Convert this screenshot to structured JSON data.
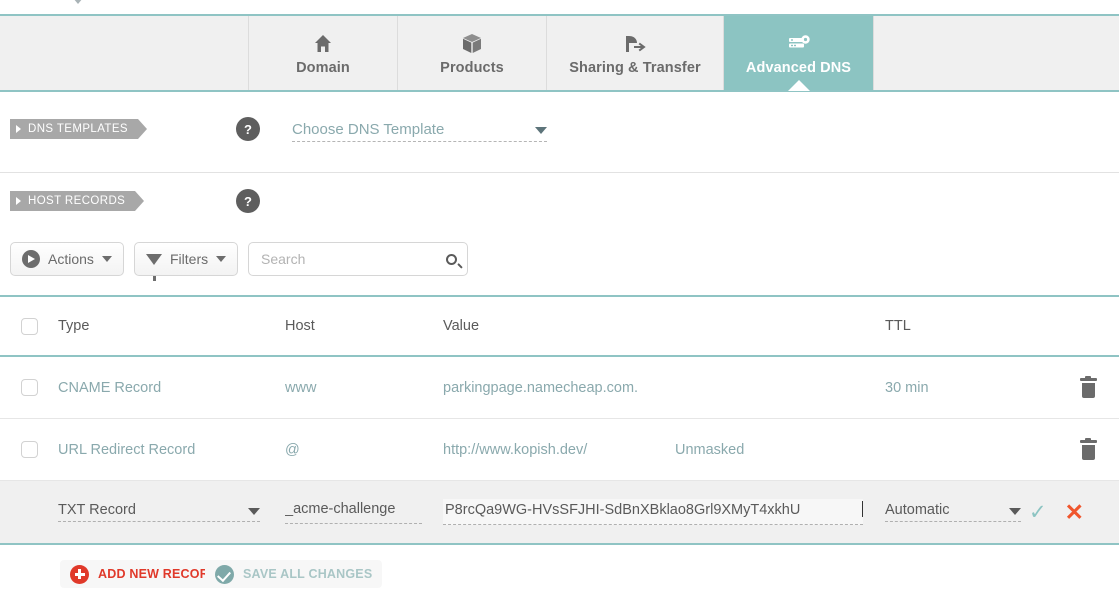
{
  "tabs": [
    {
      "label": "Domain",
      "icon": "home-icon",
      "active": false
    },
    {
      "label": "Products",
      "icon": "box-icon",
      "active": false
    },
    {
      "label": "Sharing & Transfer",
      "icon": "transfer-icon",
      "active": false
    },
    {
      "label": "Advanced DNS",
      "icon": "server-gear-icon",
      "active": true
    }
  ],
  "sections": {
    "dns_templates": {
      "label": "DNS TEMPLATES",
      "help": "?",
      "template_select": {
        "value": "Choose DNS Template"
      }
    },
    "host_records": {
      "label": "HOST RECORDS",
      "help": "?"
    }
  },
  "toolbar": {
    "actions_label": "Actions",
    "filters_label": "Filters",
    "search": {
      "value": "",
      "placeholder": "Search"
    }
  },
  "table": {
    "columns": [
      "Type",
      "Host",
      "Value",
      "TTL"
    ],
    "rows": [
      {
        "type": "CNAME Record",
        "host": "www",
        "value": "parkingpage.namecheap.com.",
        "value2": "",
        "ttl": "30 min"
      },
      {
        "type": "URL Redirect Record",
        "host": "@",
        "value": "http://www.kopish.dev/",
        "value2": "Unmasked",
        "ttl": ""
      }
    ],
    "edit_row": {
      "type": "TXT Record",
      "host": "_acme-challenge",
      "value": "P8rcQa9WG-HVsSFJHI-SdBnXBklao8Grl9XMyT4xkhU",
      "ttl": "Automatic",
      "confirm_icon": "check-icon",
      "cancel_icon": "close-icon"
    }
  },
  "footer": {
    "add_record_label": "ADD NEW RECORD",
    "save_changes_label": "SAVE ALL CHANGES"
  },
  "colors": {
    "accent_teal": "#8cc4c2",
    "link_text": "#8aa9ad",
    "danger_red": "#e0392a",
    "cancel_orange": "#f0562d",
    "ribbon_gray": "#a8a8a8"
  }
}
